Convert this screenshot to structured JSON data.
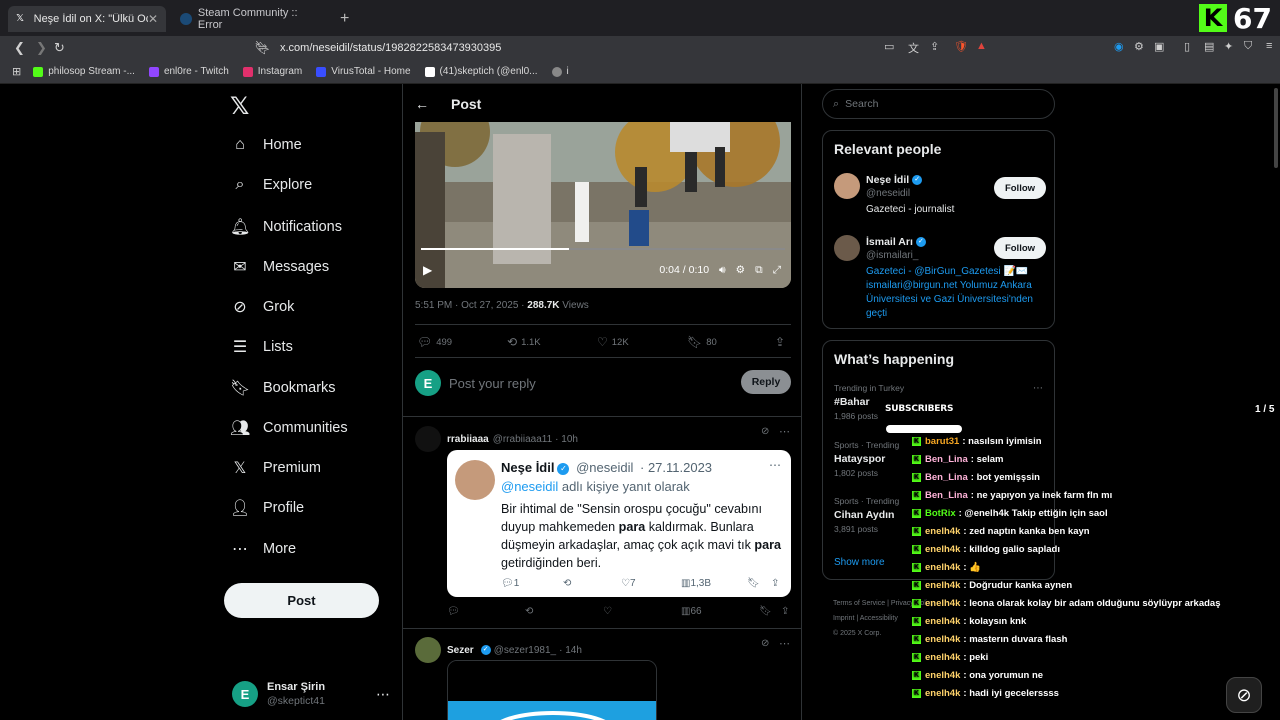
{
  "browser": {
    "tabs": [
      {
        "label": "Neşe İdil on X: \"Ülkü Ocakları te",
        "active": true
      },
      {
        "label": "Steam Community :: Error",
        "active": false
      }
    ],
    "url": "x.com/neseidil/status/1982822583473930395",
    "bookmarks": [
      {
        "label": "philosop Stream -...",
        "color": "#53fc18"
      },
      {
        "label": "enl0re - Twitch",
        "color": "#9146ff"
      },
      {
        "label": "Instagram",
        "color": "#e1306c"
      },
      {
        "label": "VirusTotal - Home",
        "color": "#394eff"
      },
      {
        "label": "(41)skeptich (@enl0...",
        "color": "#ffffff"
      },
      {
        "label": "i",
        "color": "#888888"
      }
    ]
  },
  "stream_overlay": {
    "viewer_count": "67",
    "subscribers_title": "SUBSCRIBERS",
    "page_indicator": "1 / 5",
    "chat": [
      {
        "user": "barut31",
        "color": "#f5a623",
        "message": ": nasılsın iyimisin"
      },
      {
        "user": "Ben_Lina",
        "color": "#ffb3d9",
        "message": ": selam"
      },
      {
        "user": "Ben_Lina",
        "color": "#ffb3d9",
        "message": ": bot yemişşsin"
      },
      {
        "user": "Ben_Lina",
        "color": "#ffb3d9",
        "message": ": ne yapıyon ya inek farm fln mı"
      },
      {
        "user": "BotRix",
        "color": "#53fc18",
        "message": ": @enelh4k Takip ettiğin için saol"
      },
      {
        "user": "enelh4k",
        "color": "#ffd36b",
        "message": ": zed naptın kanka ben kayn"
      },
      {
        "user": "enelh4k",
        "color": "#ffd36b",
        "message": ": killdog galio sapladı"
      },
      {
        "user": "enelh4k",
        "color": "#ffd36b",
        "message": ": 👍"
      },
      {
        "user": "enelh4k",
        "color": "#ffd36b",
        "message": ": Doğrudur kanka aynen"
      },
      {
        "user": "enelh4k",
        "color": "#ffd36b",
        "message": ": leona olarak kolay bir adam olduğunu söylüypr arkadaş"
      },
      {
        "user": "enelh4k",
        "color": "#ffd36b",
        "message": ": kolaysın knk"
      },
      {
        "user": "enelh4k",
        "color": "#ffd36b",
        "message": ": masterın duvara flash"
      },
      {
        "user": "enelh4k",
        "color": "#ffd36b",
        "message": ": peki"
      },
      {
        "user": "enelh4k",
        "color": "#ffd36b",
        "message": ": ona yorumun ne"
      },
      {
        "user": "enelh4k",
        "color": "#ffd36b",
        "message": ": hadi iyi gecelerssss"
      }
    ]
  },
  "nav": {
    "items": [
      {
        "label": "Home",
        "icon": "home-icon",
        "glyph": "⌂"
      },
      {
        "label": "Explore",
        "icon": "search-icon",
        "glyph": "⌕"
      },
      {
        "label": "Notifications",
        "icon": "bell-icon",
        "glyph": "🔔︎"
      },
      {
        "label": "Messages",
        "icon": "mail-icon",
        "glyph": "✉"
      },
      {
        "label": "Grok",
        "icon": "grok-icon",
        "glyph": "⊘"
      },
      {
        "label": "Lists",
        "icon": "list-icon",
        "glyph": "☰"
      },
      {
        "label": "Bookmarks",
        "icon": "bookmark-icon",
        "glyph": "🔖︎"
      },
      {
        "label": "Communities",
        "icon": "communities-icon",
        "glyph": "👥︎"
      },
      {
        "label": "Premium",
        "icon": "x-icon",
        "glyph": "𝕏"
      },
      {
        "label": "Profile",
        "icon": "profile-icon",
        "glyph": "👤︎"
      },
      {
        "label": "More",
        "icon": "more-icon",
        "glyph": "⋯"
      }
    ],
    "post_button": "Post",
    "account": {
      "name": "Ensar Şirin",
      "handle": "@skeptict41",
      "initial": "E"
    }
  },
  "post": {
    "title": "Post",
    "video_time": "0:04 / 0:10",
    "timestamp": "5:51 PM · Oct 27, 2025 · ",
    "views_count": "288.7K",
    "views_label": " Views",
    "stats": {
      "replies": "499",
      "reposts": "1.1K",
      "likes": "12K",
      "bookmarks": "80"
    },
    "reply_placeholder": "Post your reply",
    "reply_button": "Reply",
    "reply_initial": "E"
  },
  "replies": [
    {
      "name": "rrabiiaaa",
      "handle": "@rrabiiaaa11",
      "time": "· 10h",
      "quote": {
        "name": "Neşe İdil",
        "handle": "@neseidil",
        "date": "· 27.11.2023",
        "reply_to_handle": "@neseidil",
        "reply_to_suffix": " adlı kişiye yanıt olarak",
        "body_1": "Bir ihtimal de \"Sensin orospu çocuğu\" cevabını duyup mahkemeden ",
        "body_bold_1": "para",
        "body_2": " kaldırmak. Bunlara düşmeyin arkadaşlar, amaç çok açık mavi tık ",
        "body_bold_2": "para",
        "body_3": " getirdiğinden beri.",
        "replies": "1",
        "likes": "7",
        "views": "1,3B"
      },
      "views": "66"
    },
    {
      "name": "Sezer",
      "handle": "@sezer1981_",
      "time": "· 14h"
    }
  ],
  "sidebar": {
    "search_placeholder": "Search",
    "relevant_title": "Relevant people",
    "people": [
      {
        "name": "Neşe İdil",
        "handle": "@neseidil",
        "bio": "Gazeteci - journalist",
        "follow": "Follow"
      },
      {
        "name": "İsmail Arı",
        "handle": "@ismailari_",
        "bio_prefix": "Gazeteci - ",
        "bio_link": "@BirGun_Gazetesi",
        "bio_rest": " 📝✉️ ismailari@birgun.net Yolumuz Ankara Üniversitesi ve Gazi Üniversitesi'nden geçti",
        "follow": "Follow"
      }
    ],
    "happening_title": "What’s happening",
    "trends": [
      {
        "meta": "Trending in Turkey",
        "name": "#Bahar",
        "count": "1,986 posts"
      },
      {
        "meta": "Sports · Trending",
        "name": "Hatayspor",
        "count": "1,802 posts"
      },
      {
        "meta": "Sports · Trending",
        "name": "Cihan Aydın",
        "count": "3,891 posts"
      }
    ],
    "show_more": "Show more",
    "footer_1": "Terms of Service   |   Privacy Policy",
    "footer_2": "Imprint   |   Accessibility",
    "footer_3": "© 2025 X Corp."
  }
}
